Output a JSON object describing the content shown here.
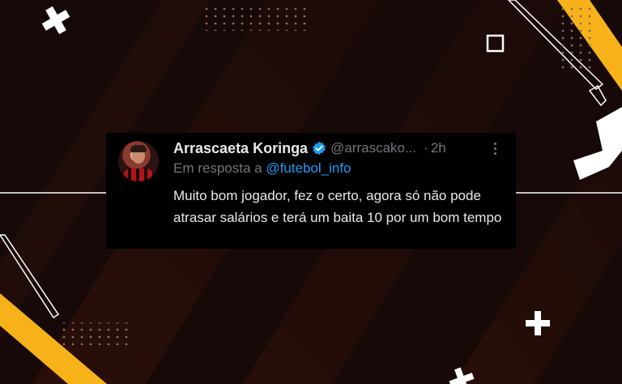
{
  "tweet": {
    "display_name": "Arrascaeta Koringa",
    "handle": "@arrascako...",
    "separator": "·",
    "time": "2h",
    "reply_prefix": "Em resposta a",
    "reply_to": "@futebol_info",
    "text": "Muito bom jogador, fez o certo, agora só não pode atrasar salários e terá um baita 10 por um bom tempo"
  },
  "icons": {
    "verified": "verified-badge-icon",
    "more": "more-options-icon",
    "plus": "plus-icon",
    "square": "square-icon"
  },
  "colors": {
    "background": "#160907",
    "card": "#000000",
    "accent_yellow": "#f7b21a",
    "verified_blue": "#1d9bf0",
    "text_primary": "#e7e9ea",
    "text_secondary": "#71767b"
  }
}
